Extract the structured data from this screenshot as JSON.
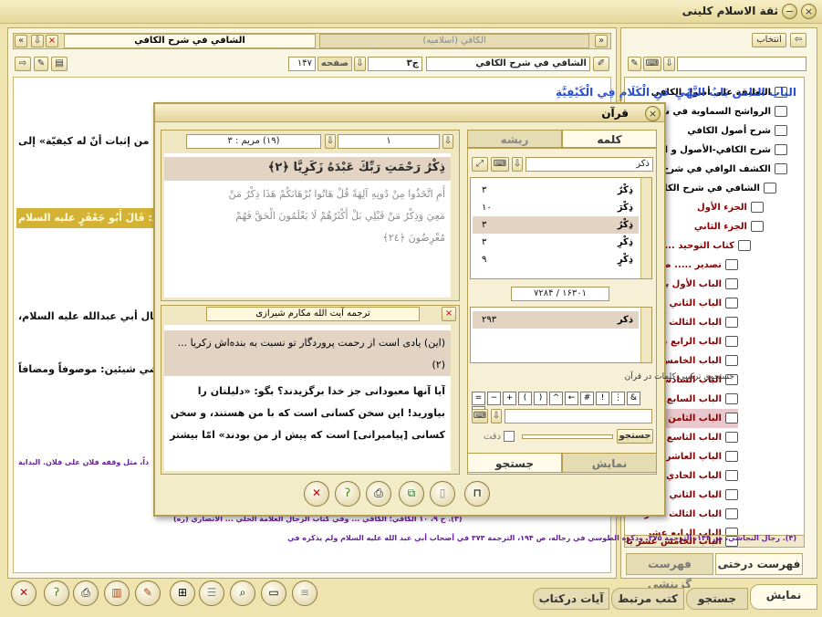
{
  "window": {
    "title": "ثقة الاسلام کلینی"
  },
  "left_panel": {
    "tab_active": "الشافي في شرح الكافي",
    "tab_inactive": "الكافي (اسلامیه)",
    "book_field": "الشافي في شرح الكافي",
    "volume_field": "ج۳",
    "page_label": "صفحه",
    "page_value": "۱۴۷",
    "heading": "الباب الثامن بَابُ النَّهْيِ عَنِ الْكَلَامِ فِي الْكَيْفِيَّةِ",
    "lines": [
      "بدّ من إثبات أنّ له كيفيّة» إلى",
      "ال: قَالَ أَبُو جَعْفَرٍ عليه السلام",
      "رجال أبي عبدالله عليه السلام،",
      "نضي شيئين: موصوفاً ومضافاً"
    ],
    "footnote_1": "داً، مثل وقفه فلان على فلان. البداية",
    "footnote_2": "(۴). رجال النجاشي، ص ۱۴۴، الترجمة ۳۷۵. وذكره الطوسي في رجاله، ص ۱۹۴، الترجمة ۳۷۳ في أصحاب أبي عبد الله عليه السلام ولم يذكره في",
    "footnote_partial": "(۳). ح ۹، ۱۰ الکافي؛ الکافي ... وفي کتاب الرجال العلامة الحلي ... الانصاري (ره)"
  },
  "right_panel": {
    "select_button": "انتخاب",
    "tree": [
      "التعليقة على أصول الكافي",
      "الرواشح السماوية في شرح الأ",
      "شرح أصول الكافي",
      "شرح الكافي-الأصول و الروضة",
      "الكشف الوافي في شرح أصول",
      "الشافي في شرح الكافي",
      "الجزء الأول",
      "الجزء الثاني",
      "كتاب التوحيد ..... ص",
      "تصدير ..... ص",
      "الباب الأول باب",
      "الباب الثاني باب",
      "الباب الثالث باب",
      "الباب الرابع باب",
      "الباب الخامس باب",
      "الباب السادس باب",
      "الباب السابع باب",
      "الباب الثامن باب",
      "الباب التاسع باب",
      "الباب العاشر باب",
      "الباب الحادي عشر",
      "الباب الثاني عشر",
      "الباب الثالث عشر",
      "الباب الرابع عشر",
      "الباب الخامس عشر باب"
    ],
    "bottom_tabs": [
      "فهرست درختی",
      "فهرست گزینشی"
    ]
  },
  "quran_window": {
    "title": "قرآن",
    "nav": {
      "verse_ref": "(۱۹) مریم : ۳",
      "page": "۱"
    },
    "verse_highlight": "ذِكْرُ رَحْمَتِ رَبِّكَ عَبْدَهُ زَكَرِيَّا ﴿٢﴾",
    "verse_next": "أَمِ اتَّخَذُوا مِنْ دُونِهِ آلِهَةً قُلْ هَاتُوا بُرْهَانَكُمْ هَذَا ذِكْرُ مَنْ",
    "verse_next_2": "مَعِيَ وَذِكْرُ مَنْ قَبْلِي بَلْ أَكْثَرُهُمْ لَا يَعْلَمُونَ الْحَقَّ فَهُمْ",
    "verse_next_3": "مُعْرِضُونَ ﴿٢٤﴾",
    "translator": "ترجمه آیت الله مکارم شیرازی",
    "translation_highlight": "(این) یادی است از رحمت پروردگار تو نسبت به بنده‌اش زکریا ... (۲)",
    "translation_lines": [
      "آیا آنها معبودانی جز خدا برگزیدند؟ بگو: «دلیلتان را",
      "بیاورید! این سخن کسانی است که با من هستند، و سخن",
      "کسانی [پیامبرانی] است که پیش از من بودند» امّا بیشتر"
    ],
    "tabs": {
      "word": "کلمه",
      "root": "ریشه"
    },
    "search_value": "ذکر",
    "results": [
      {
        "word": "ذِكْرٌ",
        "count": "۳"
      },
      {
        "word": "ذِكْرَ",
        "count": "۱۰"
      },
      {
        "word": "ذِكْرُ",
        "count": "۳"
      },
      {
        "word": "ذِكْرِ",
        "count": "۳"
      },
      {
        "word": "ذِكْرٍ",
        "count": "۹"
      }
    ],
    "totals": {
      "left": "۷۲۸۴",
      "right": "۱۶۳۰۱"
    },
    "root_results": [
      {
        "word": "ذکر",
        "count": "۲۹۳"
      }
    ],
    "combo_label": "جستجوی ترکیبی کلمات در قرآن",
    "symbols": [
      "=",
      "−",
      "+",
      "(",
      ")",
      "^",
      "←",
      "#",
      "!",
      "⋮",
      "&",
      "@"
    ],
    "search_button": "جستجو",
    "exact_label": "دقت",
    "bottom_tabs": {
      "show": "نمایش",
      "search": "جستجو"
    }
  },
  "main_tabs": [
    "نمایش",
    "جستجو",
    "کتب مرتبط",
    "آیات درکتاب"
  ],
  "colors": {
    "accent": "#efe4b0",
    "highlight": "#e3d3c2",
    "gold_band": "#d4b233",
    "tree_select": "#e8c8cc"
  }
}
